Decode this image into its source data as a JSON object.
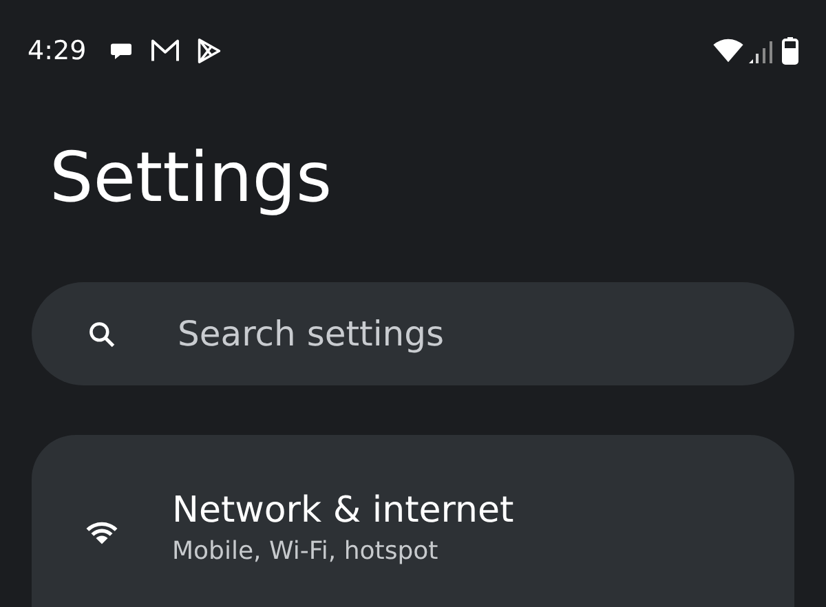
{
  "status_bar": {
    "time": "4:29"
  },
  "title": "Settings",
  "search": {
    "placeholder": "Search settings"
  },
  "items": [
    {
      "title": "Network & internet",
      "subtitle": "Mobile, Wi-Fi, hotspot"
    }
  ]
}
